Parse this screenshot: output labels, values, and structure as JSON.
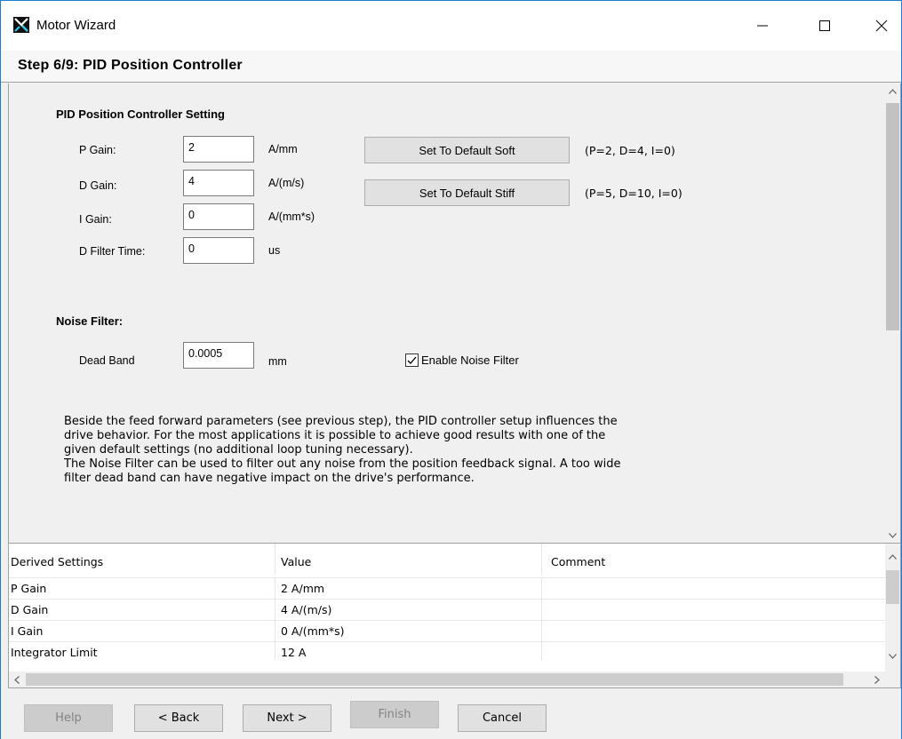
{
  "window": {
    "title": "Motor Wizard",
    "controls": {
      "minimize": "—",
      "maximize": "☐",
      "close": "✕"
    }
  },
  "step": {
    "title": "Step 6/9: PID Position Controller"
  },
  "pid": {
    "heading": "PID Position Controller Setting",
    "p_gain": {
      "label": "P Gain:",
      "value": "2",
      "unit": "A/mm"
    },
    "d_gain": {
      "label": "D Gain:",
      "value": "4",
      "unit": "A/(m/s)"
    },
    "i_gain": {
      "label": "I Gain:",
      "value": "0",
      "unit": "A/(mm*s)"
    },
    "d_filter": {
      "label": "D Filter Time:",
      "value": "0",
      "unit": "us"
    },
    "default_soft": {
      "label": "Set To Default Soft",
      "hint": "(P=2, D=4, I=0)"
    },
    "default_stiff": {
      "label": "Set To Default Stiff",
      "hint": "(P=5, D=10, I=0)"
    }
  },
  "noise": {
    "heading": "Noise Filter:",
    "dead_band": {
      "label": "Dead Band",
      "value": "0.0005",
      "unit": "mm"
    },
    "enable": {
      "label": "Enable Noise Filter",
      "checked": true
    }
  },
  "description": [
    "Beside the feed forward parameters (see previous step), the PID controller setup influences the",
    "drive behavior. For the most applications it is possible to achieve good results with one of the",
    "given default settings (no additional loop tuning necessary).",
    "The Noise Filter can be used to filter out any noise from the position feedback signal. A too wide",
    "filter dead band can have negative impact on the drive's performance."
  ],
  "table": {
    "columns": [
      "Derived Settings",
      "Value",
      "Comment"
    ],
    "rows": [
      [
        "P Gain",
        "2 A/mm",
        ""
      ],
      [
        "D Gain",
        "4 A/(m/s)",
        ""
      ],
      [
        "I Gain",
        "0 A/(mm*s)",
        ""
      ],
      [
        "Integrator Limit",
        "12 A",
        ""
      ]
    ]
  },
  "footer": {
    "help": "Help",
    "back": "< Back",
    "next": "Next >",
    "finish": "Finish",
    "cancel": "Cancel"
  }
}
